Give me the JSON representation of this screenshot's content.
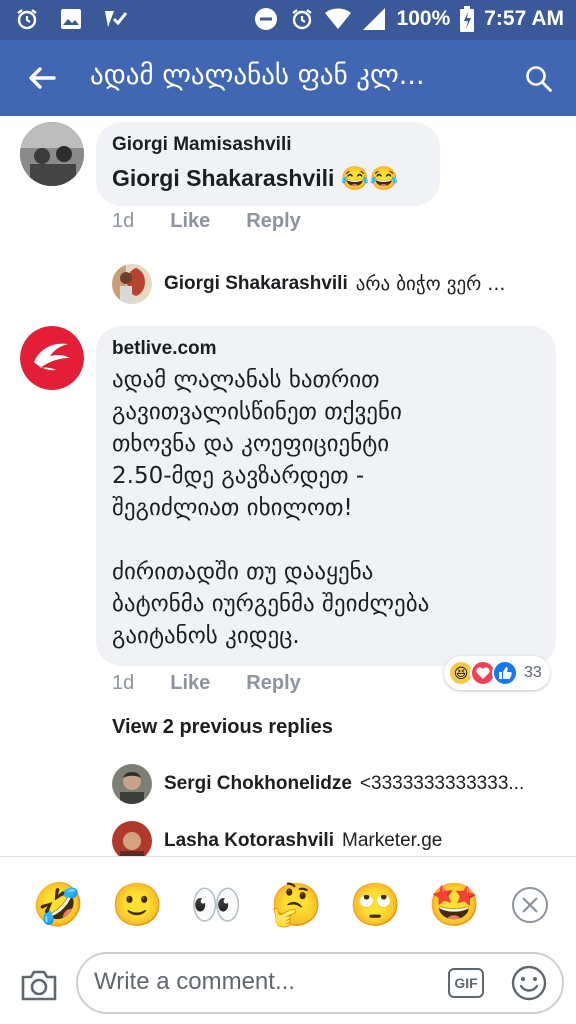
{
  "status_bar": {
    "battery": "100%",
    "time": "7:57 AM"
  },
  "header": {
    "title": "ადამ ლალანას ფან კლ..."
  },
  "comments": [
    {
      "author": "Giorgi Mamisashvili",
      "text": "Giorgi Shakarashvili 😂😂",
      "age": "1d",
      "like": "Like",
      "reply": "Reply",
      "replies": [
        {
          "author": "Giorgi Shakarashvili",
          "text": "არა ბიჭო ვერ ..."
        }
      ]
    },
    {
      "author": "betlive.com",
      "text_lines": [
        "ადამ ლალანას ხათრით",
        "გავითვალისწინეთ თქვენი",
        "თხოვნა და კოეფიციენტი",
        "2.50-მდე გავზარდეთ -",
        "შეგიძლიათ იხილოთ!",
        "",
        "ძირითადში თუ დააყენა",
        "ბატონმა იურგენმა შეიძლება",
        "გაიტანოს კიდეც."
      ],
      "age": "1d",
      "like": "Like",
      "reply": "Reply",
      "reaction_count": "33",
      "view_previous": "View 2 previous replies",
      "replies": [
        {
          "author": "Sergi Chokhonelidze",
          "text": "<3333333333333..."
        },
        {
          "author": "Lasha Kotorashvili",
          "text": "Marketer.ge"
        }
      ]
    }
  ],
  "emoji_bar": {
    "emojis": [
      "🤣",
      "🙂",
      "👀",
      "🤔",
      "🙄",
      "🤩"
    ]
  },
  "composer": {
    "placeholder": "Write a comment...",
    "gif_label": "GIF"
  },
  "colors": {
    "status_bar": "#3b5998",
    "title_bar": "#4267b2",
    "bubble": "#f0f2f5",
    "muted": "#8d949e"
  }
}
